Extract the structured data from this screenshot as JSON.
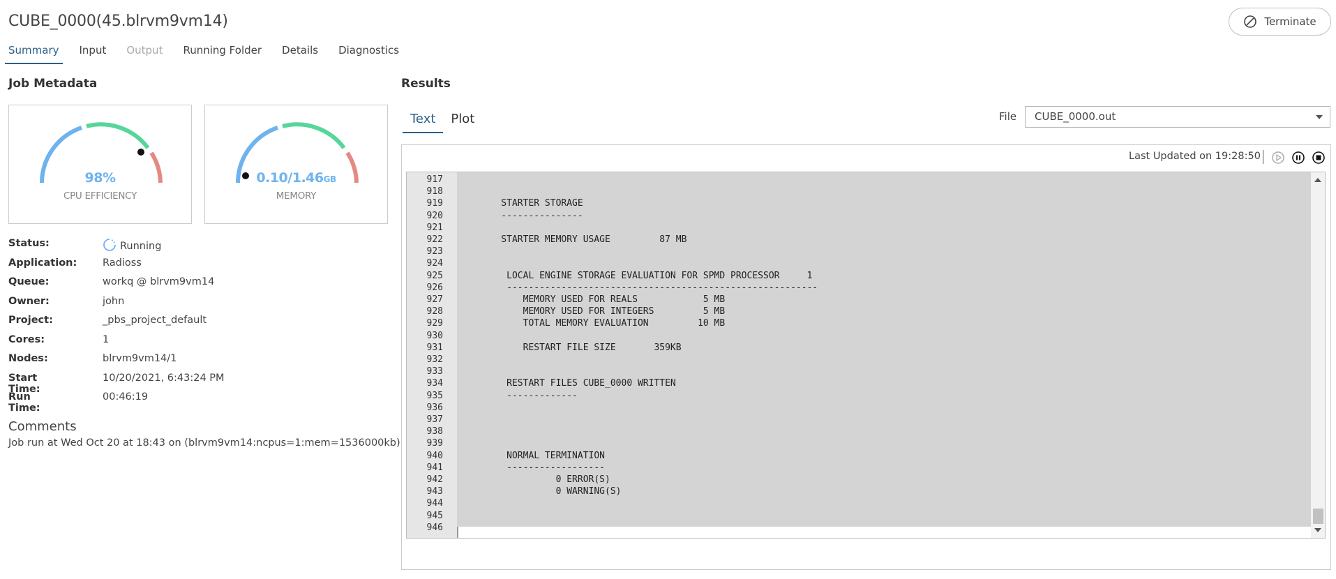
{
  "header": {
    "title": "CUBE_0000(45.blrvm9vm14)",
    "terminate_label": "Terminate"
  },
  "tabs": [
    {
      "label": "Summary",
      "state": "active"
    },
    {
      "label": "Input",
      "state": "normal"
    },
    {
      "label": "Output",
      "state": "disabled"
    },
    {
      "label": "Running Folder",
      "state": "normal"
    },
    {
      "label": "Details",
      "state": "normal"
    },
    {
      "label": "Diagnostics",
      "state": "normal"
    }
  ],
  "job_metadata": {
    "title": "Job Metadata",
    "cpu_gauge": {
      "value": "98%",
      "label": "CPU EFFICIENCY",
      "fraction": 0.98
    },
    "memory_gauge": {
      "used": "0.10",
      "total": "1.46",
      "unit": "GB",
      "label": "MEMORY",
      "fraction": 0.07
    },
    "fields": [
      {
        "key": "Status:",
        "value": "Running",
        "icon": "spinner-icon"
      },
      {
        "key": "Application:",
        "value": "Radioss"
      },
      {
        "key": "Queue:",
        "value": "workq @ blrvm9vm14"
      },
      {
        "key": "Owner:",
        "value": "john"
      },
      {
        "key": "Project:",
        "value": "_pbs_project_default"
      },
      {
        "key": "Cores:",
        "value": "1"
      },
      {
        "key": "Nodes:",
        "value": "blrvm9vm14/1"
      },
      {
        "key": "Start Time:",
        "value": "10/20/2021, 6:43:24 PM"
      },
      {
        "key": "Run Time:",
        "value": "00:46:19"
      }
    ],
    "comments_title": "Comments",
    "comments_text": "Job run at Wed Oct 20 at 18:43 on (blrvm9vm14:ncpus=1:mem=1536000kb)"
  },
  "results": {
    "title": "Results",
    "subtabs": [
      {
        "label": "Text",
        "state": "active"
      },
      {
        "label": "Plot",
        "state": "normal"
      }
    ],
    "file_label": "File",
    "file_selected": "CUBE_0000.out",
    "last_updated": "Last Updated on 19:28:50",
    "controls": [
      "play-icon",
      "pause-icon",
      "stop-icon"
    ],
    "lines": [
      {
        "n": "917",
        "t": ""
      },
      {
        "n": "918",
        "t": ""
      },
      {
        "n": "919",
        "t": "    STARTER STORAGE"
      },
      {
        "n": "920",
        "t": "    ---------------"
      },
      {
        "n": "921",
        "t": ""
      },
      {
        "n": "922",
        "t": "    STARTER MEMORY USAGE         87 MB"
      },
      {
        "n": "923",
        "t": ""
      },
      {
        "n": "924",
        "t": ""
      },
      {
        "n": "925",
        "t": "     LOCAL ENGINE STORAGE EVALUATION FOR SPMD PROCESSOR     1"
      },
      {
        "n": "926",
        "t": "     ---------------------------------------------------------"
      },
      {
        "n": "927",
        "t": "        MEMORY USED FOR REALS            5 MB"
      },
      {
        "n": "928",
        "t": "        MEMORY USED FOR INTEGERS         5 MB"
      },
      {
        "n": "929",
        "t": "        TOTAL MEMORY EVALUATION         10 MB"
      },
      {
        "n": "930",
        "t": ""
      },
      {
        "n": "931",
        "t": "        RESTART FILE SIZE       359KB"
      },
      {
        "n": "932",
        "t": ""
      },
      {
        "n": "933",
        "t": ""
      },
      {
        "n": "934",
        "t": "     RESTART FILES CUBE_0000 WRITTEN"
      },
      {
        "n": "935",
        "t": "     -------------"
      },
      {
        "n": "936",
        "t": ""
      },
      {
        "n": "937",
        "t": ""
      },
      {
        "n": "938",
        "t": ""
      },
      {
        "n": "939",
        "t": ""
      },
      {
        "n": "940",
        "t": "     NORMAL TERMINATION"
      },
      {
        "n": "941",
        "t": "     ------------------"
      },
      {
        "n": "942",
        "t": "              0 ERROR(S)"
      },
      {
        "n": "943",
        "t": "              0 WARNING(S)"
      },
      {
        "n": "944",
        "t": ""
      },
      {
        "n": "945",
        "t": ""
      },
      {
        "n": "946",
        "t": ""
      }
    ]
  },
  "colors": {
    "accent": "#2b5f8a",
    "gauge_blue": "#6fb3ee",
    "gauge_green": "#56d69a",
    "gauge_red": "#e38a83"
  }
}
